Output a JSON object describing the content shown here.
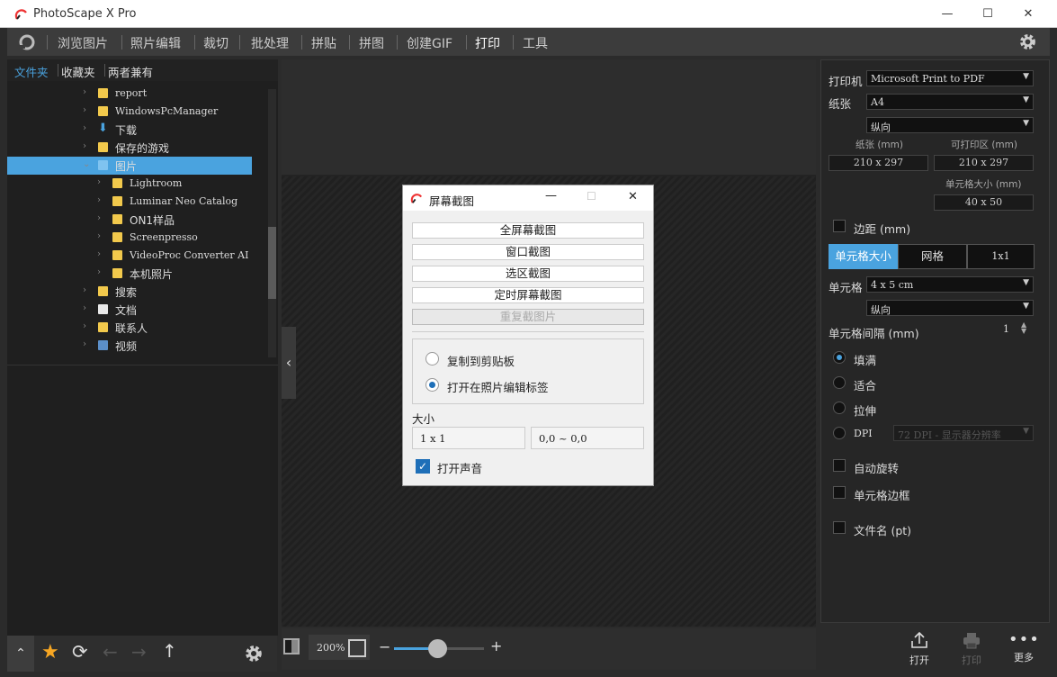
{
  "window": {
    "title": "PhotoScape X Pro",
    "min": "—",
    "max": "☐",
    "close": "✕"
  },
  "menu": {
    "items": [
      "浏览图片",
      "照片编辑",
      "裁切",
      "批处理",
      "拼贴",
      "拼图",
      "创建GIF",
      "打印",
      "工具"
    ],
    "active": "打印"
  },
  "left": {
    "tabs": [
      "文件夹",
      "收藏夹",
      "两者兼有"
    ],
    "tree": [
      {
        "label": "report",
        "level": 0,
        "icon": "folder"
      },
      {
        "label": "WindowsPcManager",
        "level": 0,
        "icon": "folder"
      },
      {
        "label": "下载",
        "level": 0,
        "icon": "download"
      },
      {
        "label": "保存的游戏",
        "level": 0,
        "icon": "folder"
      },
      {
        "label": "图片",
        "level": 0,
        "icon": "pictures",
        "selected": true,
        "expanded": true
      },
      {
        "label": "Lightroom",
        "level": 1,
        "icon": "folder"
      },
      {
        "label": "Luminar Neo Catalog",
        "level": 1,
        "icon": "folder"
      },
      {
        "label": "ON1样品",
        "level": 1,
        "icon": "folder"
      },
      {
        "label": "Screenpresso",
        "level": 1,
        "icon": "folder"
      },
      {
        "label": "VideoProc Converter AI",
        "level": 1,
        "icon": "folder"
      },
      {
        "label": "本机照片",
        "level": 1,
        "icon": "folder"
      },
      {
        "label": "搜索",
        "level": 0,
        "icon": "folder"
      },
      {
        "label": "文档",
        "level": 0,
        "icon": "doc"
      },
      {
        "label": "联系人",
        "level": 0,
        "icon": "folder"
      },
      {
        "label": "视频",
        "level": 0,
        "icon": "video"
      }
    ]
  },
  "zoom": {
    "value": "200%",
    "minus": "−",
    "plus": "+",
    "level": 0.48
  },
  "dialog": {
    "title": "屏幕截图",
    "buttons": [
      "全屏幕截图",
      "窗口截图",
      "选区截图",
      "定时屏幕截图"
    ],
    "disabled_button": "重复截图片",
    "options": [
      {
        "label": "复制到剪贴板",
        "checked": false
      },
      {
        "label": "打开在照片编辑标签",
        "checked": true
      }
    ],
    "size_label": "大小",
    "size_value": "1 x 1",
    "coords_value": "0,0 ~ 0,0",
    "sound_label": "打开声音",
    "sound_checked": true
  },
  "print": {
    "printer_label": "打印机",
    "printer_value": "Microsoft Print to PDF",
    "paper_label": "纸张",
    "paper_value": "A4",
    "orientation_value": "纵向",
    "paper_size_label": "纸张 (mm)",
    "printable_label": "可打印区 (mm)",
    "paper_size_value": "210 x 297",
    "printable_value": "210 x 297",
    "cell_size_label": "单元格大小 (mm)",
    "cell_size_value": "40 x 50",
    "margin_label": "边距 (mm)",
    "seg": [
      "单元格大小",
      "网格",
      "1x1"
    ],
    "cell_label": "单元格",
    "cell_value": "4 x 5 cm",
    "cell_orientation": "纵向",
    "spacing_label": "单元格间隔 (mm)",
    "spacing_value": "1",
    "fit": [
      {
        "label": "填满",
        "checked": true
      },
      {
        "label": "适合",
        "checked": false
      },
      {
        "label": "拉伸",
        "checked": false
      },
      {
        "label": "DPI",
        "checked": false
      }
    ],
    "dpi_value": "72 DPI - 显示器分辨率",
    "checks": [
      "自动旋转",
      "单元格边框",
      "文件名 (pt)"
    ],
    "bottom": [
      "打开",
      "打印",
      "更多"
    ]
  }
}
